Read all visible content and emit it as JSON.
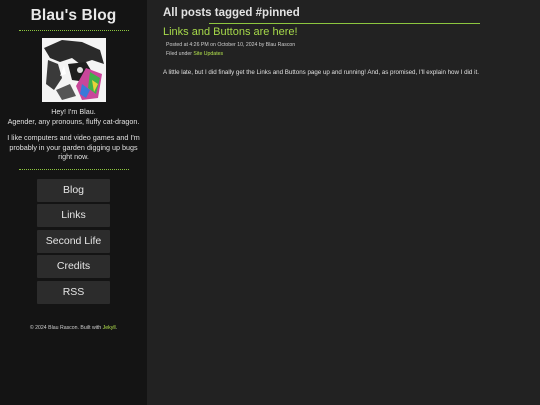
{
  "sidebar": {
    "site_title": "Blau's Blog",
    "bio_line1": "Hey! I'm Blau.",
    "bio_line2": "Agender, any pronouns, fluffy cat-dragon.",
    "bio_para2": "I like computers and video games and I'm probably in your garden digging up bugs right now.",
    "nav": [
      {
        "label": "Blog"
      },
      {
        "label": "Links"
      },
      {
        "label": "Second Life"
      },
      {
        "label": "Credits"
      },
      {
        "label": "RSS"
      }
    ],
    "footer_text": "© 2024 Blau Rascon. Built with",
    "footer_link": "Jekyll",
    "footer_end": "."
  },
  "main": {
    "page_title": "All posts tagged #pinned",
    "post": {
      "title": "Links and Buttons are here!",
      "meta_posted": "Posted at 4:26 PM on October 10, 2024 by Blau Rascon",
      "meta_filed_prefix": "Filed under",
      "category": "Site Updates",
      "excerpt": "A little late, but I did finally get the Links and Buttons page up and running! And, as promised, I'll explain how I did it."
    }
  },
  "colors": {
    "accent": "#8dc63f",
    "link": "#a6d94a",
    "sidebar_bg": "#141414",
    "main_bg": "#222222",
    "button_bg": "#2c2c2c"
  }
}
